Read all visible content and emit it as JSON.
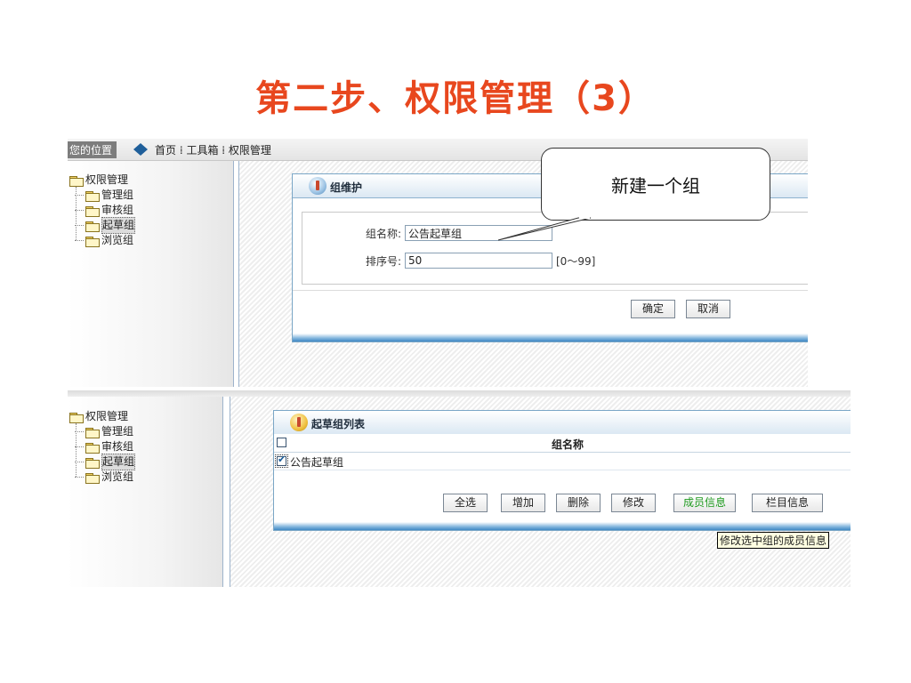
{
  "slide": {
    "title": "第二步、权限管理（3）"
  },
  "location": {
    "label": "您的位置",
    "path": "首页 ⁞ 工具箱 ⁞ 权限管理"
  },
  "tree": {
    "root": "权限管理",
    "items": [
      "管理组",
      "审核组",
      "起草组",
      "浏览组"
    ],
    "selected": "起草组"
  },
  "form_panel": {
    "title": "组维护",
    "name_label": "组名称:",
    "name_value": "公告起草组",
    "order_label": "排序号:",
    "order_value": "50",
    "order_range": "[0～99]",
    "ok_button": "确定",
    "cancel_button": "取消"
  },
  "callout": {
    "text": "新建一个组"
  },
  "list_panel": {
    "title": "起草组列表",
    "column_header": "组名称",
    "rows": [
      {
        "name": "公告起草组",
        "checked": true
      }
    ],
    "buttons": {
      "select_all": "全选",
      "add": "增加",
      "delete": "删除",
      "edit": "修改",
      "members": "成员信息",
      "columns": "栏目信息"
    },
    "tooltip": "修改选中组的成员信息"
  },
  "colors": {
    "title": "#e8471e",
    "accent": "#3f88c4",
    "members_button": "#1e9a1e"
  }
}
